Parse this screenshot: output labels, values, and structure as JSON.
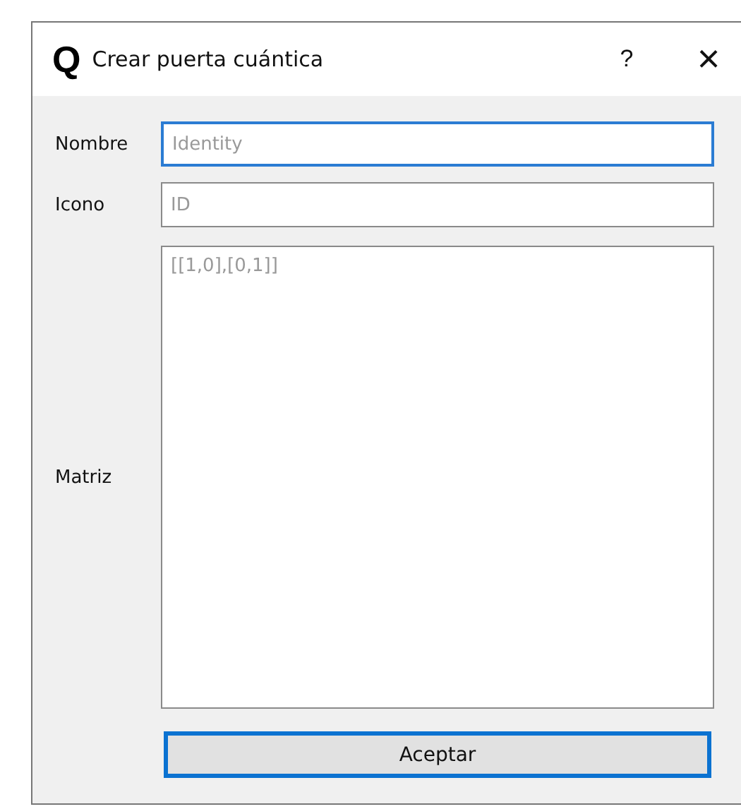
{
  "window": {
    "title": "Crear puerta cuántica",
    "logo": "Q",
    "help": "?",
    "close": "×"
  },
  "fields": [
    {
      "label": "Nombre",
      "placeholder": "Identity",
      "kind": "line",
      "focused": true
    },
    {
      "label": "Icono",
      "placeholder": "ID",
      "kind": "line",
      "focused": false
    },
    {
      "label": "Matriz",
      "placeholder": "[[1,0],[0,1]]",
      "kind": "area",
      "focused": false
    }
  ],
  "button": {
    "label": "Aceptar",
    "default": true
  }
}
